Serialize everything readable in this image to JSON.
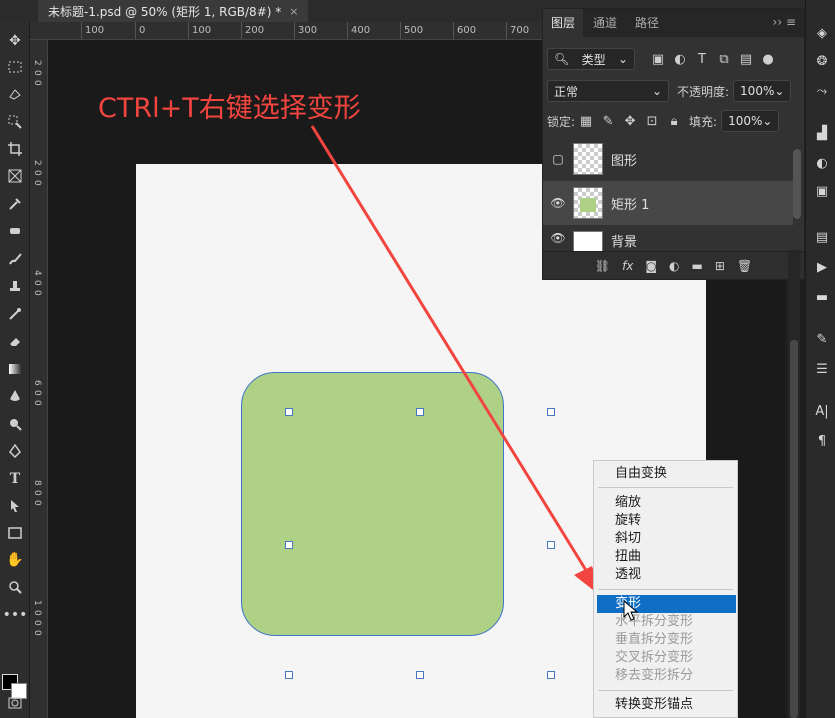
{
  "document_tab": {
    "title": "未标题-1.psd @ 50% (矩形 1, RGB/8#) *",
    "close": "×"
  },
  "ruler": {
    "top_ticks": [
      "100",
      "0",
      "100",
      "200",
      "300",
      "400",
      "500",
      "600",
      "700"
    ],
    "left_ticks": [
      "2",
      "0",
      "0",
      "2",
      "0",
      "0",
      "4",
      "0",
      "0",
      "6",
      "0",
      "0",
      "8",
      "0",
      "0",
      "1",
      "0",
      "0",
      "0"
    ]
  },
  "annotation": {
    "text": "CTRl+T右键选择变形",
    "color": "#f2453f"
  },
  "shape": {
    "fill": "#aed186",
    "stroke": "#3d73c8"
  },
  "context_menu": {
    "items": [
      {
        "label": "自由变换",
        "state": "normal"
      },
      {
        "label": "缩放",
        "state": "normal"
      },
      {
        "label": "旋转",
        "state": "normal"
      },
      {
        "label": "斜切",
        "state": "normal"
      },
      {
        "label": "扭曲",
        "state": "normal"
      },
      {
        "label": "透视",
        "state": "normal"
      },
      {
        "label": "变形",
        "state": "selected"
      },
      {
        "label": "水平拆分变形",
        "state": "disabled"
      },
      {
        "label": "垂直拆分变形",
        "state": "disabled"
      },
      {
        "label": "交叉拆分变形",
        "state": "disabled"
      },
      {
        "label": "移去变形拆分",
        "state": "disabled"
      },
      {
        "label": "转换变形锚点",
        "state": "normal"
      }
    ]
  },
  "layers_panel": {
    "tabs": [
      "图层",
      "通道",
      "路径"
    ],
    "filter_kind": "类型",
    "blend_mode": "正常",
    "opacity_label": "不透明度:",
    "opacity_value": "100%",
    "lock_label": "锁定:",
    "fill_label": "填充:",
    "fill_value": "100%",
    "layers": [
      {
        "name": "图形",
        "visible": false
      },
      {
        "name": "矩形 1",
        "visible": true,
        "selected": true
      },
      {
        "name": "背景",
        "visible": true
      }
    ]
  }
}
